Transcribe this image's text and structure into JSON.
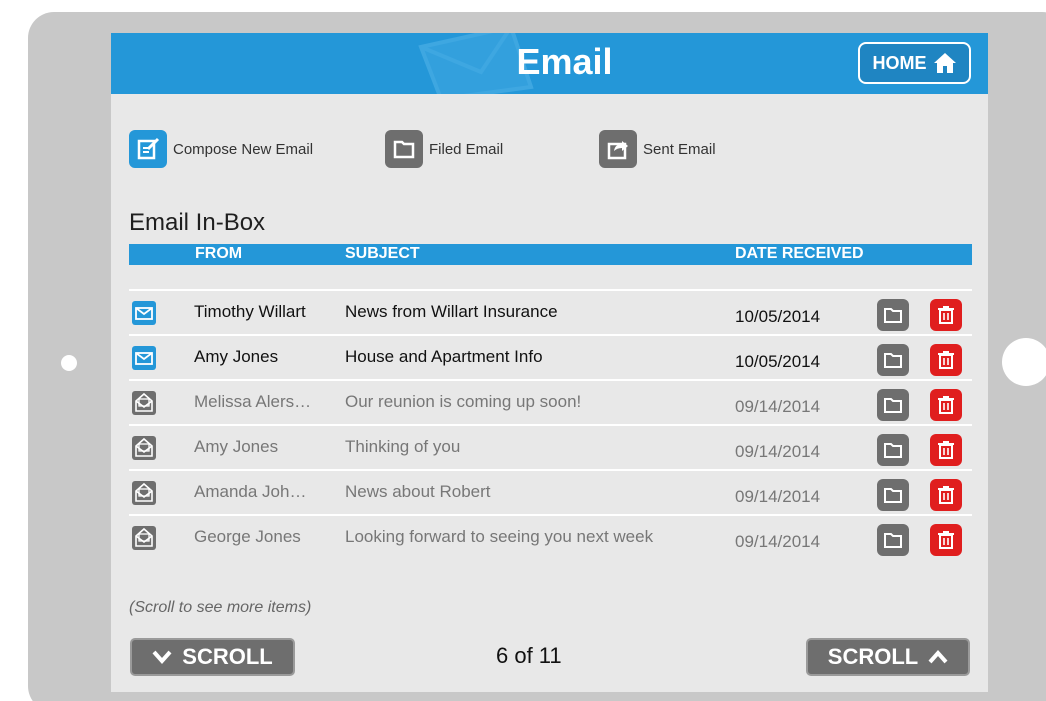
{
  "app": {
    "title": "Email",
    "home_label": "HOME"
  },
  "actions": [
    {
      "label": "Compose New Email",
      "icon": "compose-icon"
    },
    {
      "label": "Filed Email",
      "icon": "folder-icon"
    },
    {
      "label": "Sent Email",
      "icon": "sent-icon"
    }
  ],
  "inbox": {
    "title": "Email In-Box",
    "columns": {
      "from": "FROM",
      "subject": "SUBJECT",
      "date": "DATE RECEIVED"
    },
    "rows": [
      {
        "from": "Timothy Willart",
        "subject": "News from Willart Insurance",
        "date": "10/05/2014",
        "status": "unread"
      },
      {
        "from": "Amy Jones",
        "subject": "House and Apartment Info",
        "date": "10/05/2014",
        "status": "unread"
      },
      {
        "from": "Melissa Alers…",
        "subject": "Our reunion is coming up soon!",
        "date": "09/14/2014",
        "status": "read"
      },
      {
        "from": "Amy Jones",
        "subject": "Thinking of you",
        "date": "09/14/2014",
        "status": "read"
      },
      {
        "from": "Amanda Joh…",
        "subject": "News about Robert",
        "date": "09/14/2014",
        "status": "read"
      },
      {
        "from": "George Jones",
        "subject": "Looking forward to seeing you next week",
        "date": "09/14/2014",
        "status": "read"
      }
    ]
  },
  "footer": {
    "scroll_hint": "(Scroll to see more items)",
    "scroll_down_label": "SCROLL",
    "scroll_up_label": "SCROLL",
    "page_count": "6 of 11"
  },
  "colors": {
    "accent": "#2497d8",
    "delete": "#e01e1e",
    "neutral_button": "#6e6e6e"
  }
}
